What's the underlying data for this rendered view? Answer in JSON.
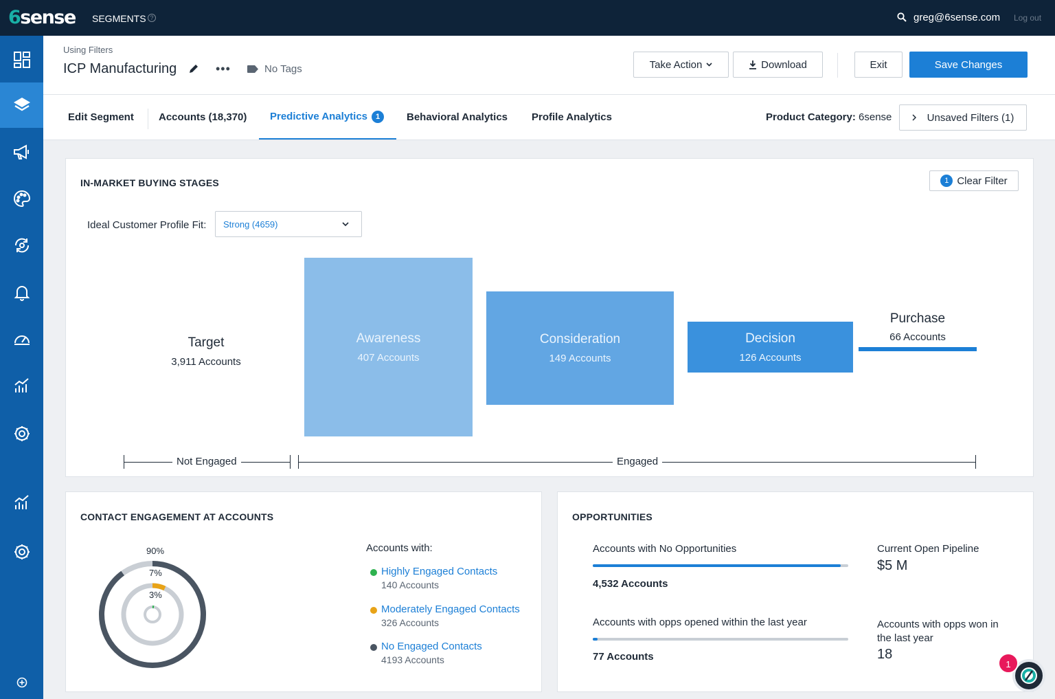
{
  "app": {
    "logo_prefix": "6",
    "logo_rest": "sense",
    "section": "SEGMENTS",
    "help": "?",
    "user_email": "greg@6sense.com",
    "logout": "Log out"
  },
  "header": {
    "breadcrumb": "Using Filters",
    "title": "ICP Manufacturing",
    "tags": "No Tags",
    "take_action": "Take Action",
    "download": "Download",
    "exit": "Exit",
    "save": "Save Changes"
  },
  "tabs": {
    "edit": "Edit Segment",
    "accounts": "Accounts (18,370)",
    "predictive": "Predictive Analytics",
    "predictive_badge": "1",
    "behavioral": "Behavioral Analytics",
    "profile": "Profile Analytics",
    "product_category_label": "Product Category:",
    "product_category_value": "6sense",
    "unsaved_filters": "Unsaved Filters (1)"
  },
  "buying_stages": {
    "title": "IN-MARKET BUYING STAGES",
    "clear_filter": "Clear Filter",
    "clear_badge": "1",
    "icp_label": "Ideal Customer Profile Fit:",
    "icp_value": "Strong (4659)",
    "stages": [
      {
        "name": "Target",
        "count": "3,911 Accounts"
      },
      {
        "name": "Awareness",
        "count": "407 Accounts"
      },
      {
        "name": "Consideration",
        "count": "149 Accounts"
      },
      {
        "name": "Decision",
        "count": "126 Accounts"
      },
      {
        "name": "Purchase",
        "count": "66 Accounts"
      }
    ],
    "not_engaged": "Not Engaged",
    "engaged": "Engaged"
  },
  "contact_engagement": {
    "title": "CONTACT ENGAGEMENT AT ACCOUNTS",
    "ring_labels": [
      "90%",
      "7%",
      "3%"
    ],
    "ring_fractions": [
      0.9,
      0.07,
      0.03
    ],
    "legend_head": "Accounts with:",
    "legend": [
      {
        "label": "Highly Engaged Contacts",
        "count": "140 Accounts",
        "color": "#2eb24f"
      },
      {
        "label": "Moderately Engaged Contacts",
        "count": "326 Accounts",
        "color": "#e8a317"
      },
      {
        "label": "No Engaged Contacts",
        "count": "4193 Accounts",
        "color": "#4a5562"
      }
    ]
  },
  "opportunities": {
    "title": "OPPORTUNITIES",
    "no_opps_label": "Accounts with No Opportunities",
    "no_opps_value": "4,532 Accounts",
    "no_opps_fraction": 0.97,
    "opened_label": "Accounts with opps opened within the last year",
    "opened_value": "77 Accounts",
    "opened_fraction": 0.02,
    "pipeline_label": "Current Open Pipeline",
    "pipeline_value": "$5 M",
    "won_label": "Accounts with opps won in the last year",
    "won_value": "18"
  },
  "assistant": {
    "badge": "1"
  },
  "colors": {
    "topbar": "#0e2339",
    "sidebar": "#0f5fa8",
    "accent": "#1c7fd6",
    "awareness": "#8bbde9",
    "consideration": "#62a6e3",
    "decision": "#3a91dd"
  }
}
